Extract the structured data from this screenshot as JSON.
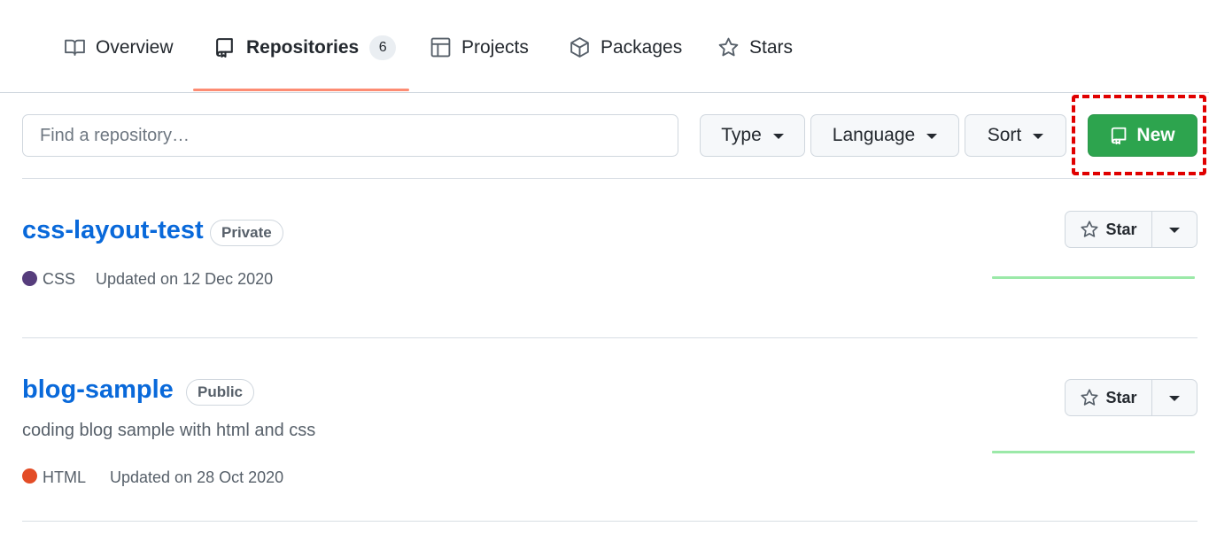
{
  "tabs": [
    {
      "label": "Overview",
      "icon": "book-icon"
    },
    {
      "label": "Repositories",
      "icon": "repo-icon",
      "count": "6",
      "selected": true
    },
    {
      "label": "Projects",
      "icon": "table-icon"
    },
    {
      "label": "Packages",
      "icon": "package-icon"
    },
    {
      "label": "Stars",
      "icon": "star-icon"
    }
  ],
  "search": {
    "placeholder": "Find a repository…"
  },
  "filters": {
    "type_label": "Type",
    "language_label": "Language",
    "sort_label": "Sort"
  },
  "new_button": {
    "label": "New",
    "icon": "repo-icon"
  },
  "colors": {
    "accent_link": "#0969da",
    "new_button_bg": "#2da44e",
    "tab_underline": "#fd8c73",
    "highlight": "#e00000",
    "sparkline": "#9be9a8"
  },
  "repos": [
    {
      "name": "css-layout-test",
      "visibility": "Private",
      "description": "",
      "language": "CSS",
      "language_color": "#563d7c",
      "updated": "Updated on 12 Dec 2020",
      "star_label": "Star"
    },
    {
      "name": "blog-sample",
      "visibility": "Public",
      "description": "coding blog sample with html and css",
      "language": "HTML",
      "language_color": "#e34c26",
      "updated": "Updated on 28 Oct 2020",
      "star_label": "Star"
    }
  ]
}
